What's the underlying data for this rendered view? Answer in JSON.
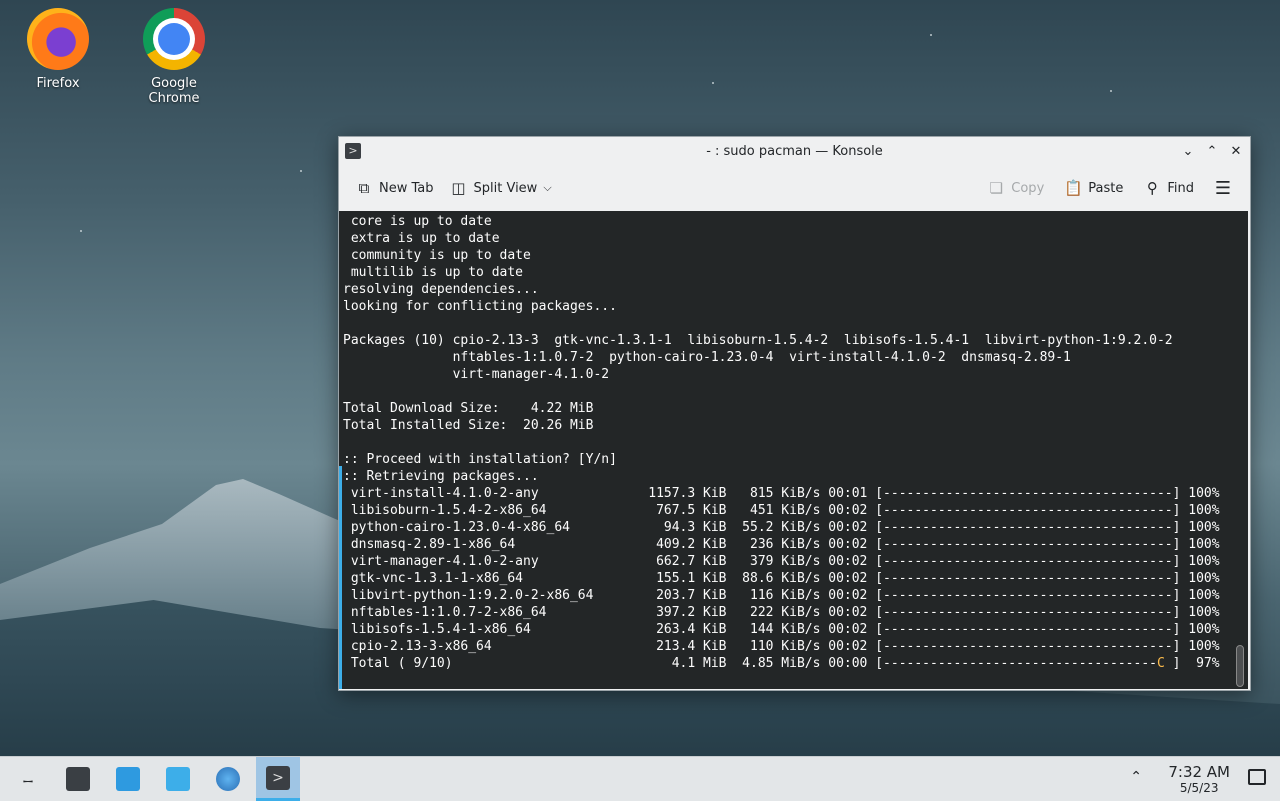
{
  "desktop": {
    "icons": [
      {
        "label": "Firefox"
      },
      {
        "label": "Google Chrome"
      }
    ]
  },
  "window": {
    "title": "- : sudo pacman — Konsole",
    "toolbar": {
      "new_tab": "New Tab",
      "split_view": "Split View",
      "copy": "Copy",
      "paste": "Paste",
      "find": "Find"
    },
    "terminal": {
      "lines": [
        " core is up to date",
        " extra is up to date",
        " community is up to date",
        " multilib is up to date",
        "resolving dependencies...",
        "looking for conflicting packages...",
        "",
        "Packages (10) cpio-2.13-3  gtk-vnc-1.3.1-1  libisoburn-1.5.4-2  libisofs-1.5.4-1  libvirt-python-1:9.2.0-2",
        "              nftables-1:1.0.7-2  python-cairo-1.23.0-4  virt-install-4.1.0-2  dnsmasq-2.89-1",
        "              virt-manager-4.1.0-2",
        "",
        "Total Download Size:    4.22 MiB",
        "Total Installed Size:  20.26 MiB",
        "",
        ":: Proceed with installation? [Y/n]",
        ":: Retrieving packages...",
        " virt-install-4.1.0-2-any              1157.3 KiB   815 KiB/s 00:01 [-------------------------------------] 100%",
        " libisoburn-1.5.4-2-x86_64              767.5 KiB   451 KiB/s 00:02 [-------------------------------------] 100%",
        " python-cairo-1.23.0-4-x86_64            94.3 KiB  55.2 KiB/s 00:02 [-------------------------------------] 100%",
        " dnsmasq-2.89-1-x86_64                  409.2 KiB   236 KiB/s 00:02 [-------------------------------------] 100%",
        " virt-manager-4.1.0-2-any               662.7 KiB   379 KiB/s 00:02 [-------------------------------------] 100%",
        " gtk-vnc-1.3.1-1-x86_64                 155.1 KiB  88.6 KiB/s 00:02 [-------------------------------------] 100%",
        " libvirt-python-1:9.2.0-2-x86_64        203.7 KiB   116 KiB/s 00:02 [-------------------------------------] 100%",
        " nftables-1:1.0.7-2-x86_64              397.2 KiB   222 KiB/s 00:02 [-------------------------------------] 100%",
        " libisofs-1.5.4-1-x86_64                263.4 KiB   144 KiB/s 00:02 [-------------------------------------] 100%",
        " cpio-2.13-3-x86_64                     213.4 KiB   110 KiB/s 00:02 [-------------------------------------] 100%"
      ],
      "total_line_prefix": " Total ( 9/10)                            4.1 MiB  4.85 MiB/s 00:00 [-----------------------------------",
      "total_line_cursor": "C",
      "total_line_suffix": " ]  97%"
    }
  },
  "taskbar": {
    "clock_time": "7:32 AM",
    "clock_date": "5/5/23"
  },
  "colors": {
    "terminal_bg": "#232627",
    "accent": "#3daee9",
    "progress_cursor": "#fdbc4b"
  }
}
